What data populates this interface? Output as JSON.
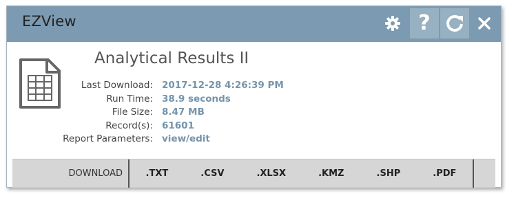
{
  "window": {
    "title": "EZView"
  },
  "header_buttons": {
    "settings_icon": "gear-icon",
    "help_label": "?",
    "refresh_icon": "refresh-icon",
    "close_icon": "close-icon"
  },
  "report": {
    "icon": "spreadsheet-file-icon",
    "title": "Analytical Results II",
    "details": [
      {
        "label": "Last Download:",
        "value": "2017-12-28 4:26:39 PM"
      },
      {
        "label": "Run Time:",
        "value": "38.9 seconds"
      },
      {
        "label": "File Size:",
        "value": "8.47 MB"
      },
      {
        "label": "Record(s):",
        "value": "61601"
      },
      {
        "label": "Report Parameters:",
        "value": "view/edit"
      }
    ]
  },
  "download": {
    "label": "DOWNLOAD",
    "formats": [
      ".TXT",
      ".CSV",
      ".XLSX",
      ".KMZ",
      ".SHP",
      ".PDF"
    ]
  },
  "colors": {
    "header": "#7c9bb2",
    "value_text": "#7494ac",
    "download_bar": "#d6d6d6"
  }
}
